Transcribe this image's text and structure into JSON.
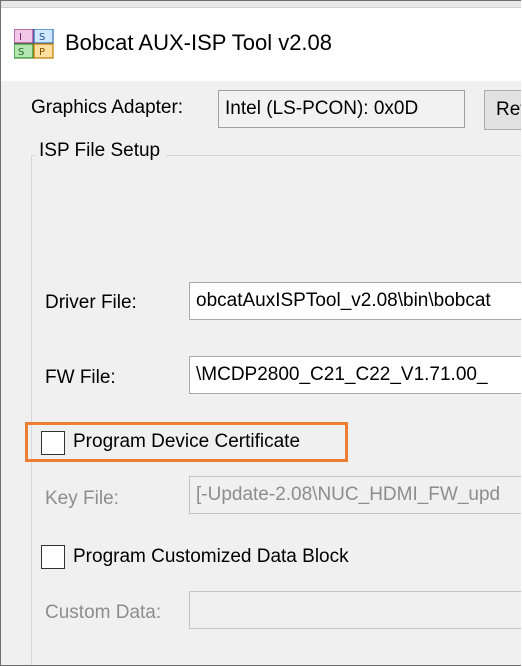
{
  "window": {
    "title": "Bobcat AUX-ISP Tool v2.08",
    "icon": "app-grid-icon"
  },
  "adapter": {
    "label": "Graphics Adapter:",
    "value": "Intel (LS-PCON): 0x0D",
    "refresh_label": "Refresh"
  },
  "isp_group": {
    "caption": "ISP File Setup",
    "driver_file": {
      "label": "Driver File:",
      "value": "obcatAuxISPTool_v2.08\\bin\\bobcat"
    },
    "fw_file": {
      "label": "FW File:",
      "value": "\\MCDP2800_C21_C22_V1.71.00_"
    },
    "program_cert": {
      "label": "Program Device Certificate",
      "checked": false,
      "highlight_color": "#ed7d31"
    },
    "key_file": {
      "label": "Key File:",
      "value": "[-Update-2.08\\NUC_HDMI_FW_upd"
    },
    "program_custom": {
      "label": "Program Customized Data Block",
      "checked": false
    },
    "custom_data": {
      "label": "Custom Data:",
      "value": ""
    }
  }
}
